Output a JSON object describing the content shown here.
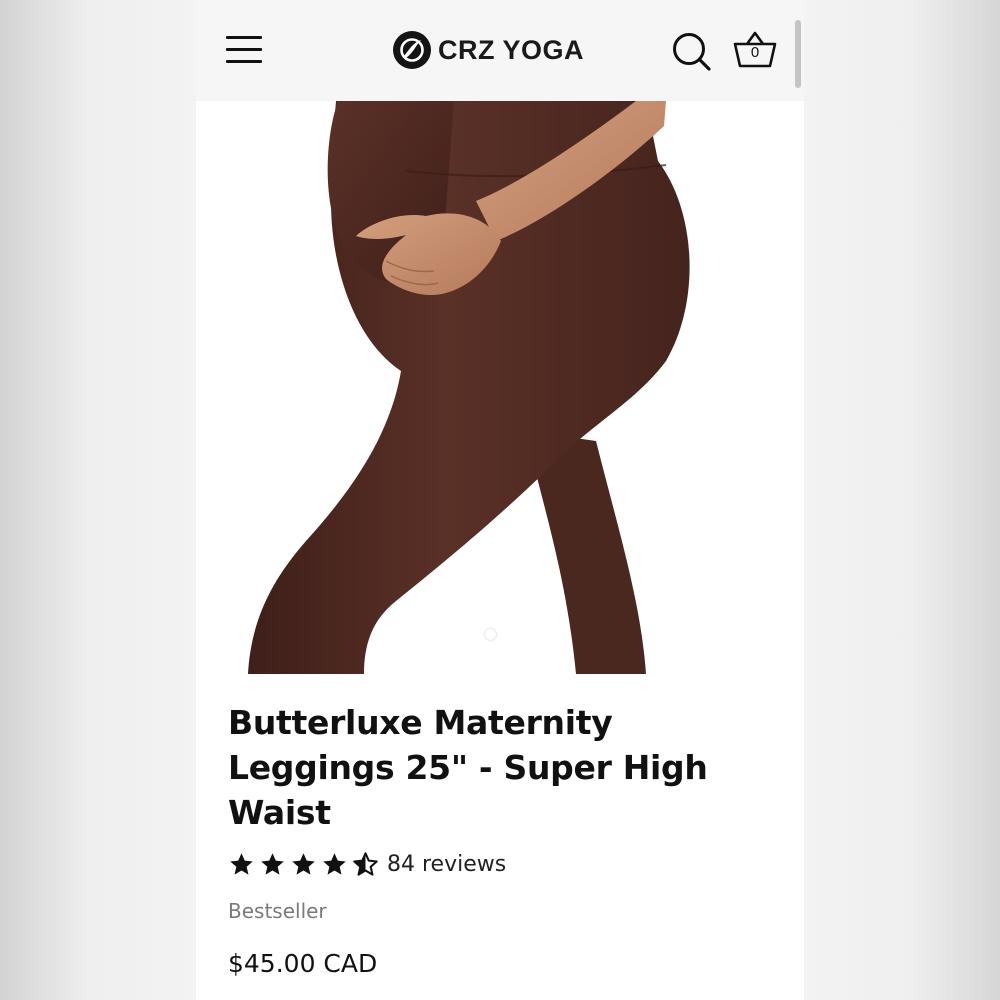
{
  "header": {
    "brand_name": "CRZ YOGA",
    "cart_count": "0",
    "icons": {
      "menu": "hamburger-menu-icon",
      "logo": "crz-logo-mark",
      "search": "search-icon",
      "cart": "basket-icon"
    }
  },
  "gallery": {
    "slides": 2,
    "active_slide": 2,
    "product_color": "#4e2a22"
  },
  "product": {
    "title": "Butterluxe Maternity Leggings 25\" - Super High Waist",
    "rating": {
      "value": 4.5,
      "max": 5,
      "reviews_label": "84 reviews"
    },
    "badge": "Bestseller",
    "price": "$45.00 CAD"
  },
  "colors": {
    "text": "#111111",
    "muted": "#7a7a7a",
    "header_bg": "#f6f6f6"
  }
}
